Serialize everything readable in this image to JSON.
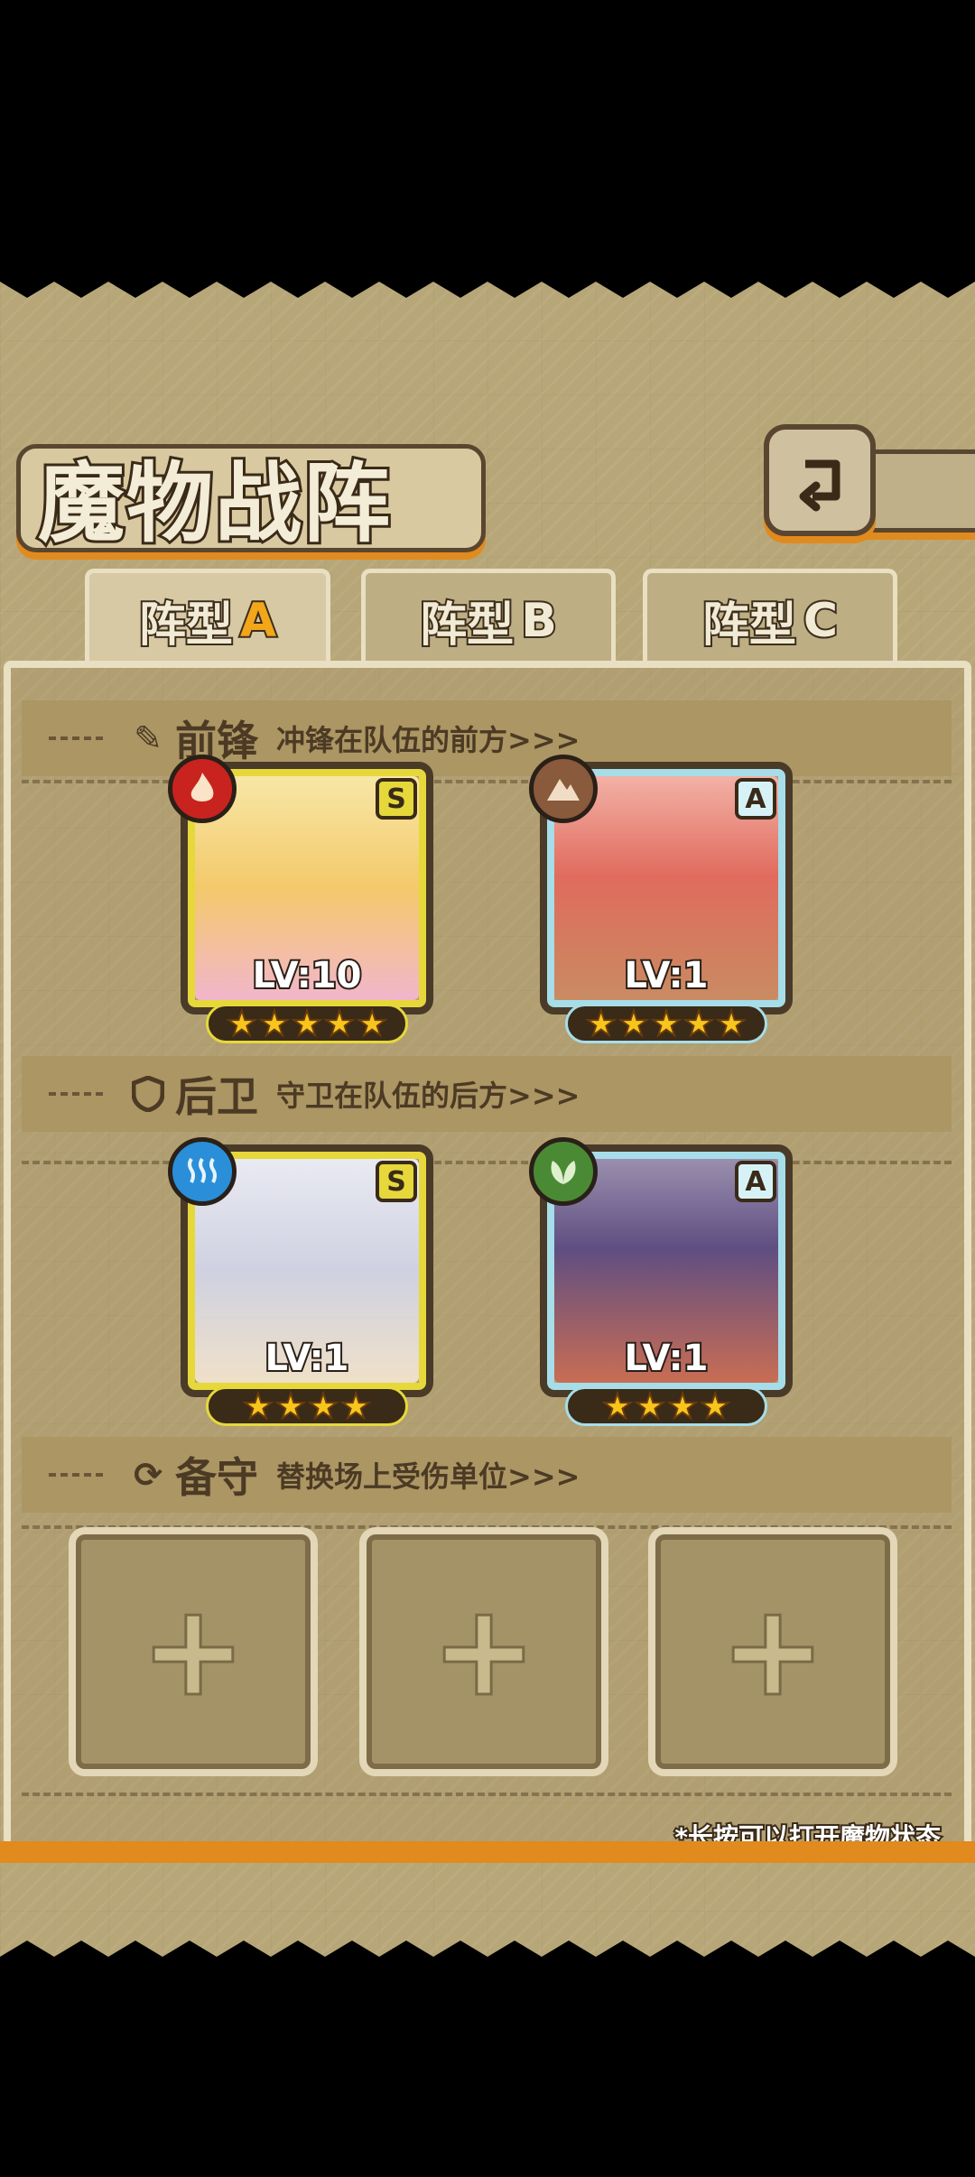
{
  "title": "魔物战阵",
  "tabs": [
    {
      "prefix": "阵型",
      "letter": "A",
      "active": true
    },
    {
      "prefix": "阵型",
      "letter": "B",
      "active": false
    },
    {
      "prefix": "阵型",
      "letter": "C",
      "active": false
    }
  ],
  "sections": {
    "front": {
      "head": "前锋",
      "desc": "冲锋在队伍的前方>>>"
    },
    "back": {
      "head": "后卫",
      "desc": "守卫在队伍的后方>>>"
    },
    "reserve": {
      "head": "备守",
      "desc": "替换场上受伤单位>>>"
    }
  },
  "units": [
    {
      "rank": "S",
      "level": "LV:10",
      "stars": 5,
      "element": "fire"
    },
    {
      "rank": "A",
      "level": "LV:1",
      "stars": 5,
      "element": "earth"
    },
    {
      "rank": "S",
      "level": "LV:1",
      "stars": 4,
      "element": "water"
    },
    {
      "rank": "A",
      "level": "LV:1",
      "stars": 4,
      "element": "wind"
    }
  ],
  "reserve_slots": [
    "+",
    "+",
    "+"
  ],
  "hint": "*长按可以打开魔物状态",
  "colors": {
    "accent": "#e18a1e",
    "rank_s": "#e6d83a",
    "rank_a": "#a6dde9",
    "fire": "#c8231e",
    "earth": "#8a5a3c",
    "water": "#2a8fd8",
    "wind": "#4b8a34"
  }
}
